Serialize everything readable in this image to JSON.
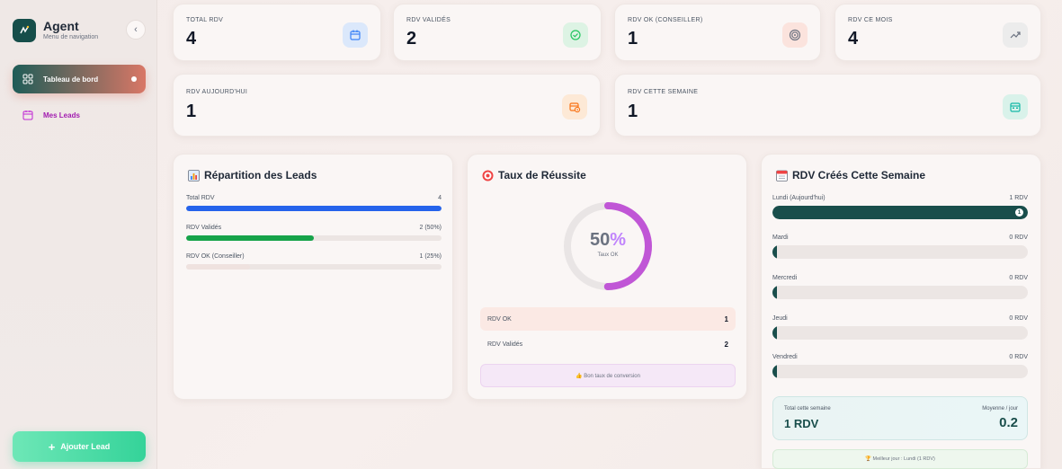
{
  "sidebar": {
    "brand_title": "Agent",
    "brand_subtitle": "Menu de navigation",
    "collapse_glyph": "‹",
    "items": [
      {
        "label": "Tableau de bord",
        "icon": "dashboard-grid-icon",
        "active": true
      },
      {
        "label": "Mes Leads",
        "icon": "calendar-icon",
        "active": false
      }
    ],
    "add_button_label": "Ajouter Lead",
    "add_button_icon": "plus-icon"
  },
  "stats": [
    {
      "label": "TOTAL RDV",
      "value": "4",
      "icon": "calendar-icon",
      "icon_bg": "#dbe8fb",
      "icon_color": "#3b82f6"
    },
    {
      "label": "RDV VALIDÉS",
      "value": "2",
      "icon": "check-circle-icon",
      "icon_bg": "#ddf3e4",
      "icon_color": "#22c55e"
    },
    {
      "label": "RDV OK (CONSEILLER)",
      "value": "1",
      "icon": "target-icon",
      "icon_bg": "#fbe3dd",
      "icon_color": "#6b7280"
    },
    {
      "label": "RDV CE MOIS",
      "value": "4",
      "icon": "trending-up-icon",
      "icon_bg": "#ececec",
      "icon_color": "#6b7280"
    },
    {
      "label": "RDV AUJOURD'HUI",
      "value": "1",
      "icon": "calendar-clock-icon",
      "icon_bg": "#fde9d6",
      "icon_color": "#f97316"
    },
    {
      "label": "RDV CETTE SEMAINE",
      "value": "1",
      "icon": "calendar-week-icon",
      "icon_bg": "#d9f2ea",
      "icon_color": "#14b8a6"
    }
  ],
  "repartition": {
    "title": "Répartition des Leads",
    "icon": "bar-chart-icon",
    "rows": [
      {
        "label": "Total RDV",
        "value": "4",
        "fraction": 1.0,
        "color": "#2563eb"
      },
      {
        "label": "RDV Validés",
        "value": "2 (50%)",
        "fraction": 0.5,
        "color": "#16a34a"
      },
      {
        "label": "RDV OK (Conseiller)",
        "value": "1 (25%)",
        "fraction": 0.25,
        "color": "#efe2df"
      }
    ]
  },
  "taux": {
    "title": "Taux de Réussite",
    "icon": "target-icon",
    "percent_number": "50",
    "percent_sign": "%",
    "fraction": 0.5,
    "ring_color": "#c056d6",
    "sub_label": "Taux OK",
    "rows": [
      {
        "label": "RDV OK",
        "value": "1",
        "bg": "#fbe9e4"
      },
      {
        "label": "RDV Validés",
        "value": "2",
        "bg": "#faf6f5"
      }
    ],
    "tip": "👍 Bon taux de conversion"
  },
  "semaine": {
    "title": "RDV Créés Cette Semaine",
    "icon": "calendar-icon",
    "days": [
      {
        "label": "Lundi (Aujourd'hui)",
        "value": "1 RDV",
        "count": 1,
        "badge": "1"
      },
      {
        "label": "Mardi",
        "value": "0 RDV",
        "count": 0
      },
      {
        "label": "Mercredi",
        "value": "0 RDV",
        "count": 0
      },
      {
        "label": "Jeudi",
        "value": "0 RDV",
        "count": 0
      },
      {
        "label": "Vendredi",
        "value": "0 RDV",
        "count": 0
      }
    ],
    "max_count": 1,
    "total_label": "Total cette semaine",
    "total_value": "1 RDV",
    "avg_label": "Moyenne / jour",
    "avg_value": "0.2",
    "best_day": "🏆 Meilleur jour : Lundi (1 RDV)"
  }
}
